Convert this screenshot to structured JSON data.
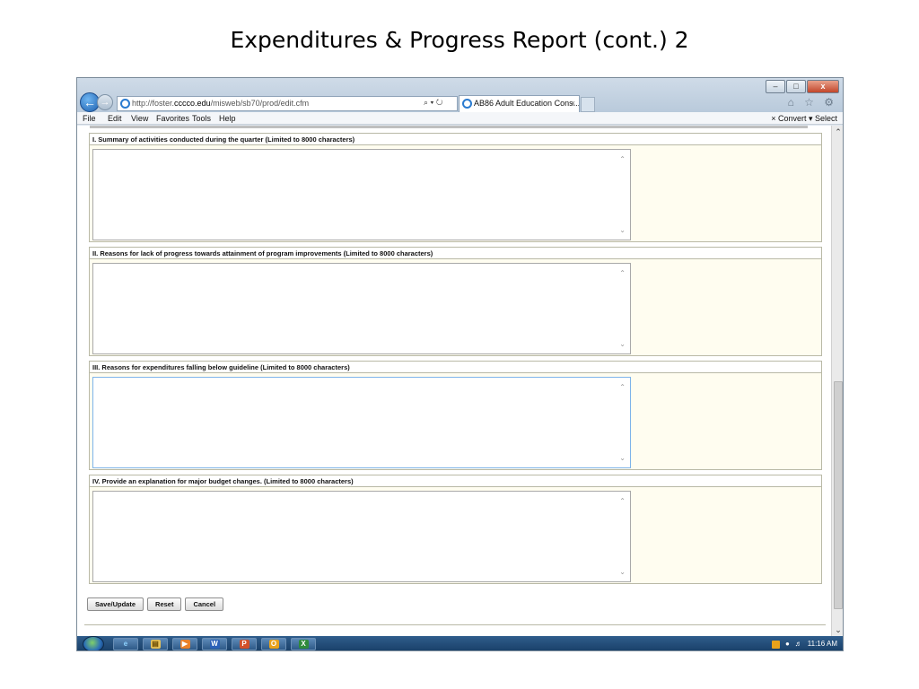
{
  "slide": {
    "title": "Expenditures & Progress Report (cont.) 2"
  },
  "browser": {
    "url_prefix": "http://foster.",
    "url_domain": "cccco.edu",
    "url_path": "/misweb/sb70/prod/edit.cfm",
    "addr_tools": "⌕ ▾ ↻",
    "tab_title": "AB86 Adult Education Cons...",
    "tab_close": "×",
    "window_controls": [
      "–",
      "□",
      "x"
    ],
    "right_icons": "⌂ ☆ ⚙"
  },
  "menu": {
    "items": [
      "File",
      "Edit",
      "View",
      "Favorites",
      "Tools",
      "Help"
    ],
    "right": "×  Convert  ▾  Select"
  },
  "sections": [
    {
      "title": "I. Summary of activities conducted during the quarter (Limited to 8000 characters)"
    },
    {
      "title": "II. Reasons for lack of progress towards attainment of program improvements (Limited to 8000 characters)"
    },
    {
      "title": "III. Reasons for expenditures falling below guideline (Limited to 8000 characters)"
    },
    {
      "title": "IV. Provide an explanation for major budget changes. (Limited to 8000 characters)"
    }
  ],
  "buttons": {
    "save": "Save/Update",
    "reset": "Reset",
    "cancel": "Cancel"
  },
  "taskbar": {
    "apps": [
      "e",
      "▤",
      "▶",
      "W",
      "P",
      "O",
      "X"
    ],
    "clock": "11:16 AM"
  }
}
